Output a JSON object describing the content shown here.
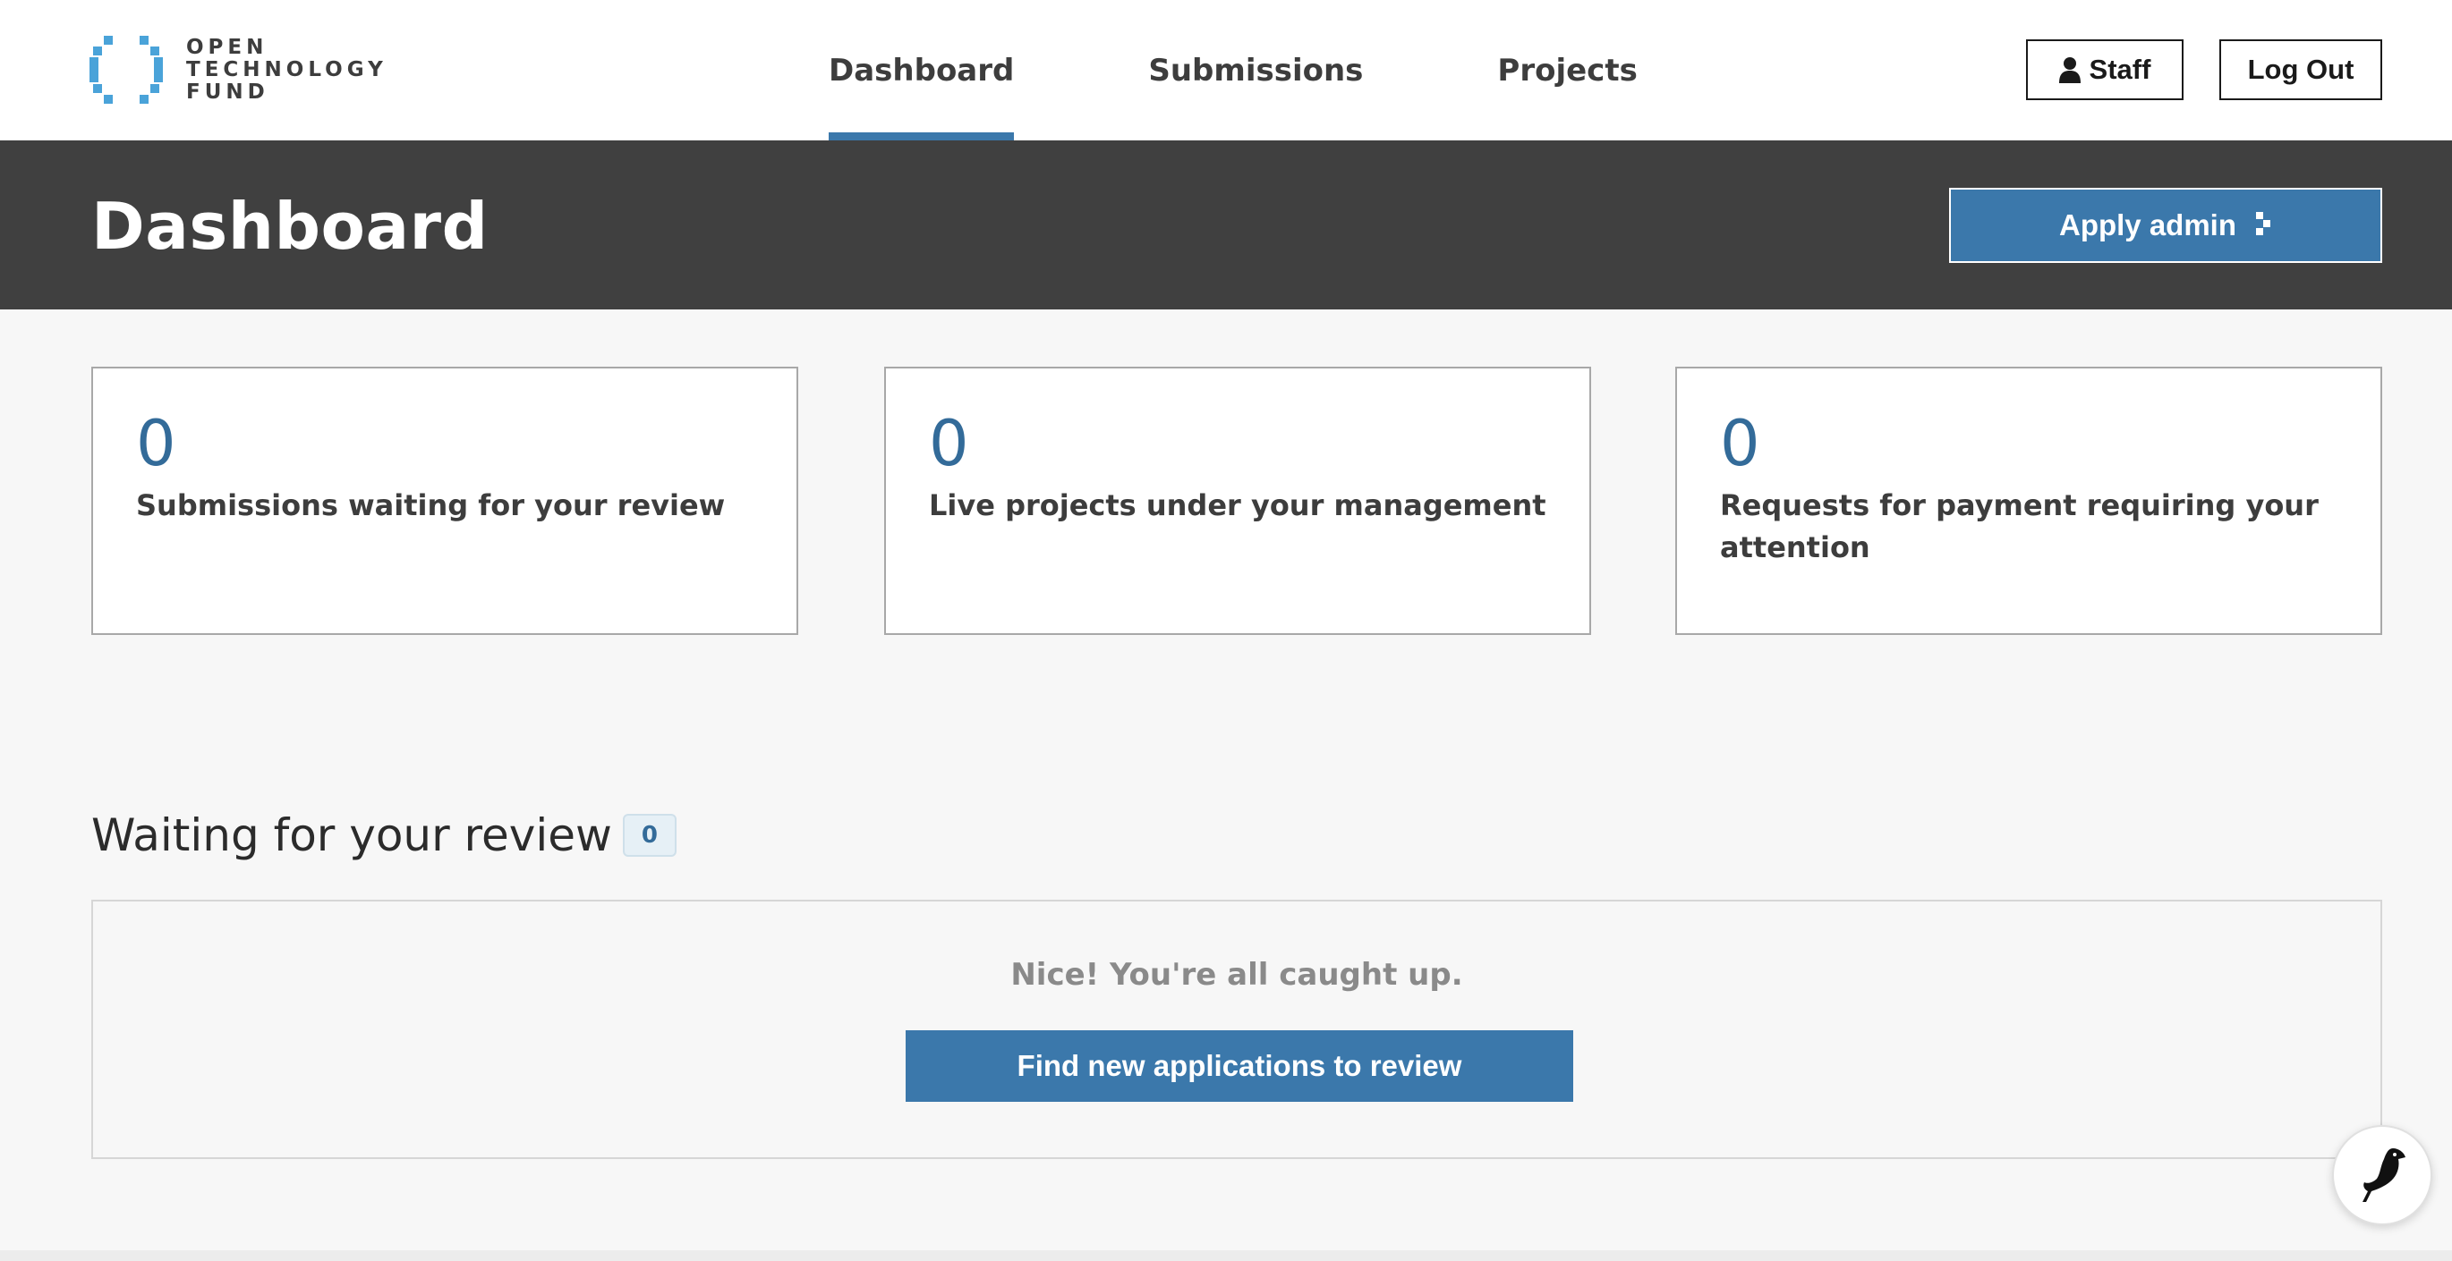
{
  "brand": {
    "logo_lines": [
      "OPEN",
      "TECHNOLOGY",
      "FUND"
    ],
    "logo_color": "#4aa3d9"
  },
  "nav": {
    "items": [
      {
        "label": "Dashboard",
        "active": true
      },
      {
        "label": "Submissions",
        "active": false
      },
      {
        "label": "Projects",
        "active": false
      }
    ],
    "accent": "#3b78ab"
  },
  "header_actions": {
    "staff_label": "Staff",
    "staff_icon": "user-icon",
    "logout_label": "Log Out"
  },
  "title_bar": {
    "title": "Dashboard",
    "apply_admin_label": "Apply admin",
    "apply_admin_icon": "arrow-right-icon"
  },
  "stats": [
    {
      "value": "0",
      "label": "Submissions waiting for your review"
    },
    {
      "value": "0",
      "label": "Live projects under your management"
    },
    {
      "value": "0",
      "label": "Requests for payment requiring your attention"
    }
  ],
  "waiting": {
    "title": "Waiting for your review",
    "count": "0",
    "empty_message": "Nice! You're all caught up.",
    "find_button_label": "Find new applications to review"
  },
  "floating_button": {
    "icon": "bird-icon"
  }
}
